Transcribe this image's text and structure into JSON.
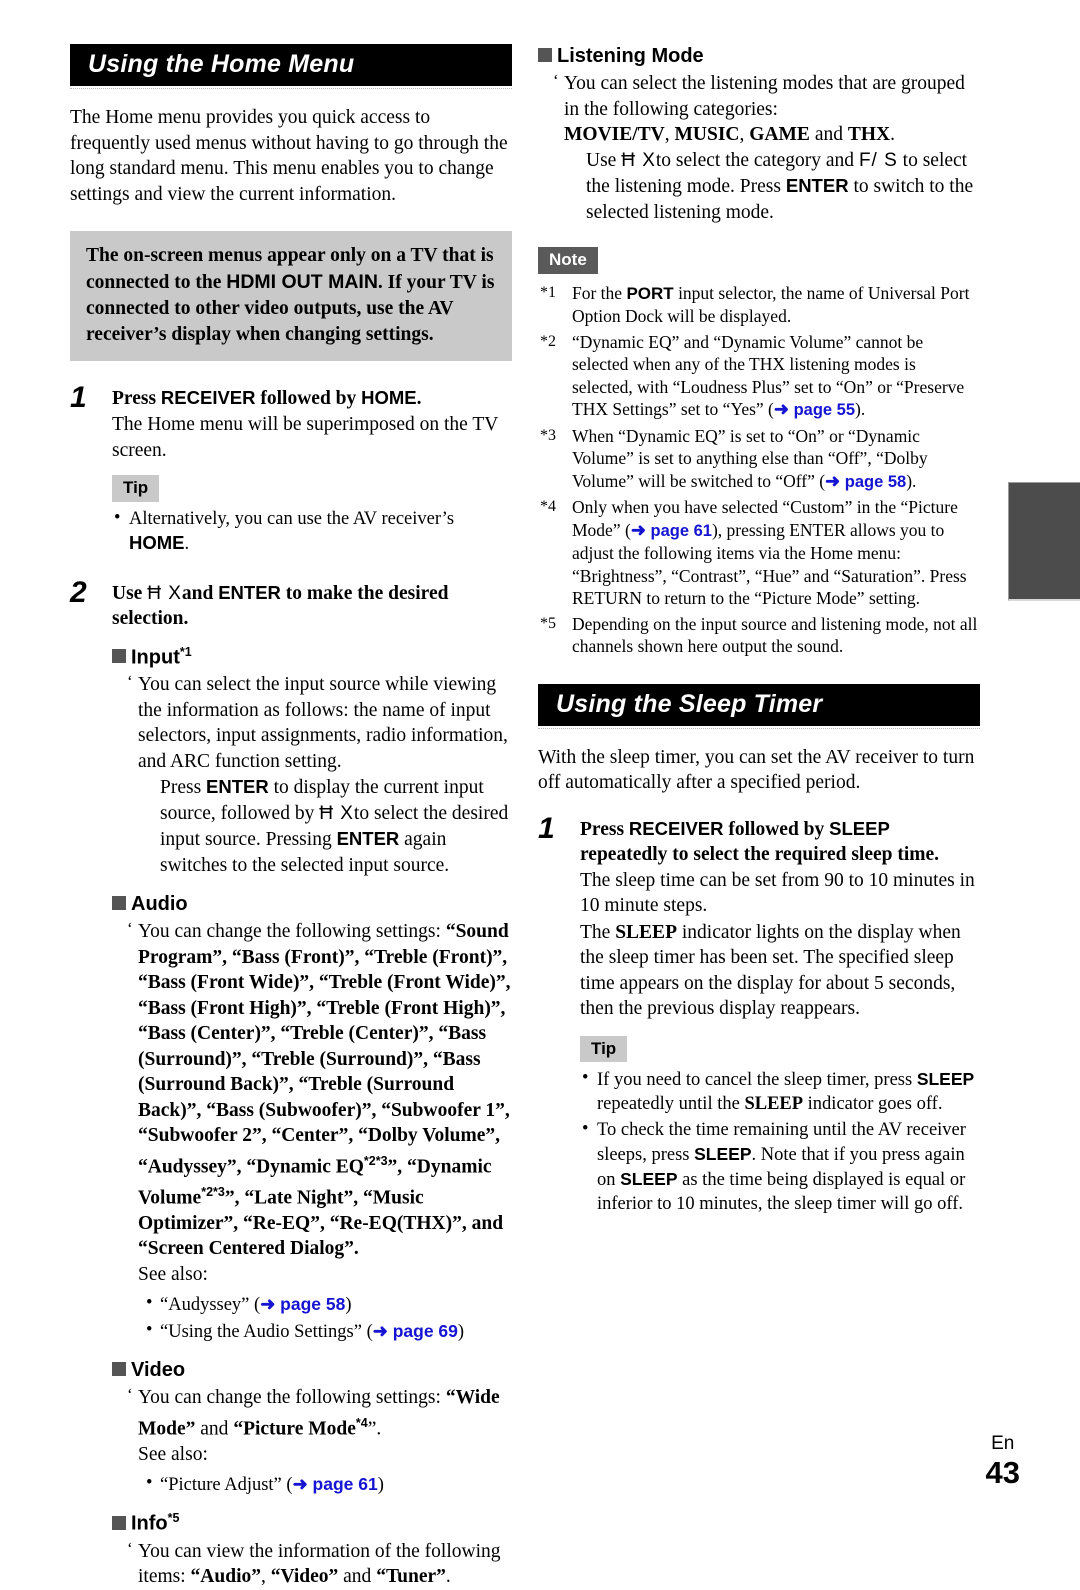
{
  "left_column": {
    "section_title": "Using the Home Menu",
    "intro": "The Home menu provides you quick access to frequently used menus without having to go through the long standard menu. This menu enables you to change settings and view the current information.",
    "callout": {
      "part1": "The on-screen menus appear only on a TV that is connected to the ",
      "hdmi": "HDMI OUT MAIN",
      "part2": ". If your TV is connected to other video outputs, use the AV receiver’s display when changing settings."
    },
    "step1": {
      "number": "1",
      "title_a": "Press ",
      "title_key1": "RECEIVER",
      "title_b": " followed by ",
      "title_key2": "HOME",
      "title_c": ".",
      "body": "The Home menu will be superimposed on the TV screen.",
      "tip_label": "Tip",
      "tip_bullet_a": "Alternatively, you can use the AV receiver’s ",
      "tip_bullet_key": "HOME",
      "tip_bullet_b": "."
    },
    "step2": {
      "number": "2",
      "title_a": "Use ",
      "glyph_updown": "Ħ X",
      "title_b": "and ",
      "title_key": "ENTER",
      "title_c": " to make the desired selection."
    },
    "input": {
      "heading": "Input",
      "footnote": "*1",
      "desc": "You can select the input source while viewing the information as follows: the name of input selectors, input assignments, radio information, and ARC function setting.",
      "inner_a": "Press ",
      "inner_key1": "ENTER",
      "inner_b": " to display the current input source, followed by ",
      "glyph_updown": "Ħ X",
      "inner_c": "to select the desired input source. Pressing ",
      "inner_key2": "ENTER",
      "inner_d": " again switches to the selected input source."
    },
    "audio": {
      "heading": "Audio",
      "desc_lead": "You can change the following settings: ",
      "settings": "“Sound Program”, “Bass (Front)”, “Treble (Front)”, “Bass (Front Wide)”, “Treble (Front Wide)”, “Bass (Front High)”, “Treble (Front High)”, “Bass (Center)”, “Treble (Center)”, “Bass (Surround)”, “Treble (Surround)”, “Bass (Surround Back)”, “Treble (Surround Back)”, “Bass (Subwoofer)”, “Subwoofer 1”, “Subwoofer 2”, “Center”, “Dolby Volume”, “Audyssey”, “Dynamic EQ",
      "sup_23_a": "*2*3",
      "settings_mid": "”, “Dynamic Volume",
      "sup_23_b": "*2*3",
      "settings_end": "”, “Late Night”, “Music Optimizer”, “Re-EQ”, “Re-EQ(THX)”, and “Screen Centered Dialog”.",
      "see_also": "See also:",
      "link1_text": "“Audyssey” (",
      "link1_page": "page 58",
      "link2_text": "“Using the Audio Settings” (",
      "link2_page": "page 69"
    },
    "video": {
      "heading": "Video",
      "desc_lead": "You can change the following settings: ",
      "settings_a": "“Wide Mode”",
      "and": " and ",
      "settings_b": "“Picture Mode",
      "sup_4": "*4",
      "settings_c": "”.",
      "see_also": "See also:",
      "link_text": "“Picture Adjust” (",
      "link_page": "page 61"
    },
    "info": {
      "heading": "Info",
      "footnote": "*5",
      "desc_a": "You can view the information of the following items: ",
      "item1": "“Audio”",
      "sep1": ", ",
      "item2": "“Video”",
      "sep2": " and ",
      "item3": "“Tuner”",
      "end": "."
    }
  },
  "right_column": {
    "listening_mode": {
      "heading": "Listening Mode",
      "desc": "You can select the listening modes that are grouped in the following categories:",
      "categories_a": "MOVIE/TV",
      "categories_sep1": ", ",
      "categories_b": "MUSIC",
      "categories_sep2": ", ",
      "categories_c": "GAME",
      "categories_sep3": " and ",
      "categories_d": "THX",
      "categories_end": ".",
      "inner_a": "Use ",
      "glyph_updown": "Ħ X",
      "inner_b": "to select the category and ",
      "glyph_leftright": "F/ S",
      "inner_c": " to select the listening mode. Press ",
      "inner_key": "ENTER",
      "inner_d": " to switch to the selected listening mode."
    },
    "note": {
      "label": "Note",
      "items": [
        {
          "mark": "*1",
          "a": "For the ",
          "key": "PORT",
          "b": " input selector, the name of Universal Port Option Dock will be displayed."
        },
        {
          "mark": "*2",
          "a": "“Dynamic EQ” and “Dynamic Volume” cannot be selected when any of the THX listening modes is selected, with “Loudness Plus” set to “On” or “Preserve THX Settings” set to “Yes” (",
          "page": "page 55",
          "b": ")."
        },
        {
          "mark": "*3",
          "a": "When “Dynamic EQ” is set to “On” or “Dynamic Volume” is set to anything else than “Off”, “Dolby Volume” will be switched to “Off” (",
          "page": "page 58",
          "b": ")."
        },
        {
          "mark": "*4",
          "a": "Only when you have selected “Custom” in the “Picture Mode” (",
          "page": "page 61",
          "b": "), pressing ENTER allows you to adjust the following items via the Home menu: “Brightness”, “Contrast”, “Hue” and “Saturation”. Press RETURN to return to the “Picture Mode” setting."
        },
        {
          "mark": "*5",
          "a": "Depending on the input source and listening mode, not all channels shown here output the sound.",
          "page": "",
          "b": ""
        }
      ]
    },
    "sleep_section": {
      "section_title": "Using the Sleep Timer",
      "intro": "With the sleep timer, you can set the AV receiver to turn off automatically after a specified period.",
      "step1": {
        "number": "1",
        "title_a": "Press ",
        "title_key1": "RECEIVER",
        "title_b": " followed by ",
        "title_key2": "SLEEP",
        "title_c": " repeatedly to select the required sleep time.",
        "body1": "The sleep time can be set from 90 to 10 minutes in 10 minute steps.",
        "body2_a": "The ",
        "body2_key": "SLEEP",
        "body2_b": " indicator lights on the display when the sleep timer has been set. The specified sleep time appears on the display for about 5 seconds, then the previous display reappears."
      },
      "tip_label": "Tip",
      "tip1_a": "If you need to cancel the sleep timer, press ",
      "tip1_key1": "SLEEP",
      "tip1_b": " repeatedly until the ",
      "tip1_key2": "SLEEP",
      "tip1_c": " indicator goes off.",
      "tip2_a": "To check the time remaining until the AV receiver sleeps, press ",
      "tip2_key1": "SLEEP",
      "tip2_b": ". Note that if you press again on ",
      "tip2_key2": "SLEEP",
      "tip2_c": " as the time being displayed is equal or inferior to 10 minutes, the sleep timer will go off."
    }
  },
  "footer": {
    "language": "En",
    "page_number": "43"
  },
  "colors": {
    "banner_bg": "#000000",
    "callout_bg": "#c9c9c9",
    "note_chip_bg": "#5a5a5a",
    "link_blue": "#1414d2",
    "thumb_tab": "#4c4c4c"
  }
}
